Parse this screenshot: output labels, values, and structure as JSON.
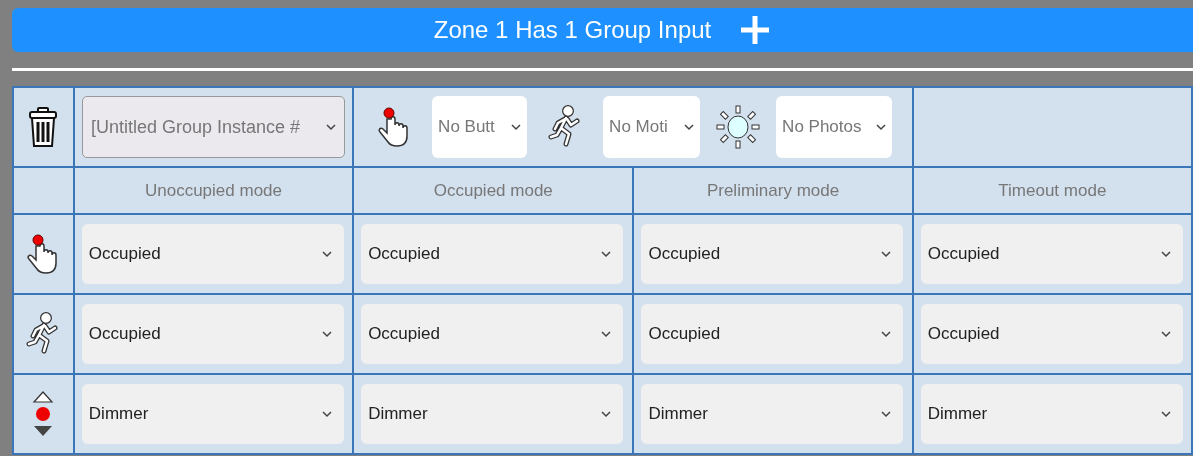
{
  "title": "Zone 1 Has 1 Group Input",
  "group": {
    "instance": "[Untitled Group Instance #",
    "inputs": [
      {
        "kind": "button",
        "value": "No Butt"
      },
      {
        "kind": "motion",
        "value": "No Moti"
      },
      {
        "kind": "photo",
        "value": "No Photos"
      }
    ]
  },
  "columns": [
    "Unoccupied mode",
    "Occupied mode",
    "Preliminary mode",
    "Timeout mode"
  ],
  "rows": [
    {
      "kind": "button",
      "cells": [
        "Occupied",
        "Occupied",
        "Occupied",
        "Occupied"
      ]
    },
    {
      "kind": "motion",
      "cells": [
        "Occupied",
        "Occupied",
        "Occupied",
        "Occupied"
      ]
    },
    {
      "kind": "dimmer",
      "cells": [
        "Dimmer",
        "Dimmer",
        "Dimmer",
        "Dimmer"
      ]
    }
  ]
}
